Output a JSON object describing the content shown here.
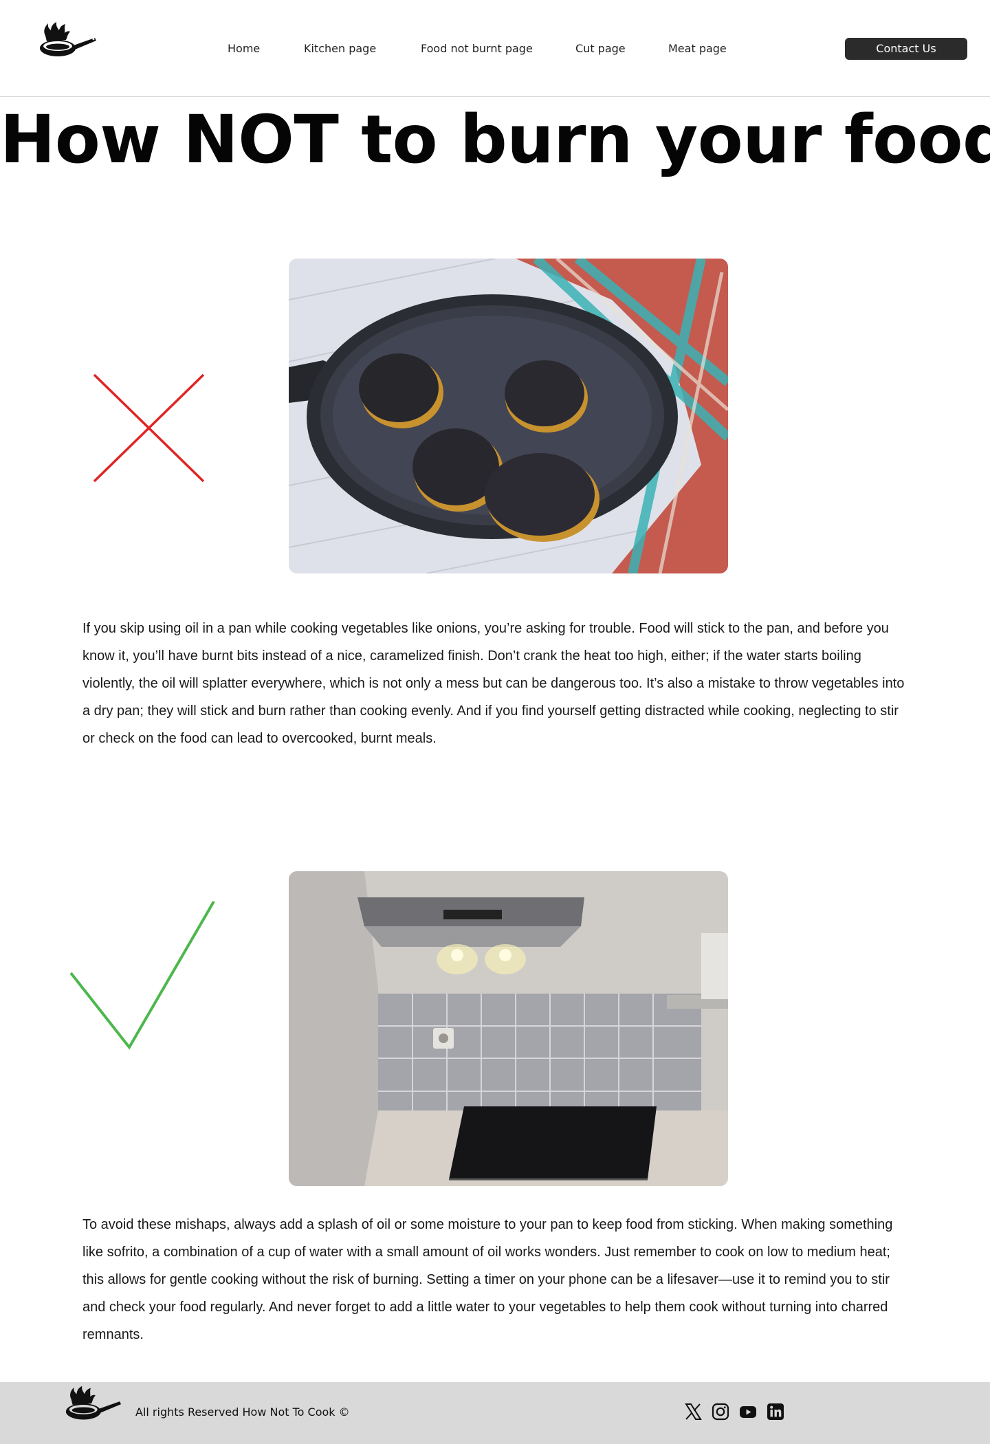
{
  "nav": {
    "items": [
      {
        "label": "Home"
      },
      {
        "label": "Kitchen page"
      },
      {
        "label": "Food not burnt page"
      },
      {
        "label": "Cut page"
      },
      {
        "label": "Meat page"
      }
    ],
    "contact_label": "Contact Us"
  },
  "page": {
    "title": "How NOT to burn your food"
  },
  "sections": [
    {
      "mark_icon": "red-x-icon",
      "mark_color": "#e02424",
      "image": "burnt-food-in-pan",
      "text": "If you skip using oil in a pan while cooking vegetables like onions, you’re asking for trouble. Food will stick to the pan, and before you know it, you’ll have burnt bits instead of a nice, caramelized finish. Don’t crank the heat too high, either; if the water starts boiling violently, the oil will splatter everywhere, which is not only a mess but can be dangerous too. It’s also a mistake to throw vegetables into a dry pan; they will stick and burn rather than cooking evenly. And if you find yourself getting distracted while cooking, neglecting to stir or check on the food can lead to overcooked, burnt meals."
    },
    {
      "mark_icon": "green-check-icon",
      "mark_color": "#4cb84c",
      "image": "clean-kitchen-stove",
      "text": "To avoid these mishaps, always add a splash of oil or some moisture to your pan to keep food from sticking. When making something like sofrito, a combination of a cup of water with a small amount of oil works wonders. Just remember to cook on low to medium heat; this allows for gentle cooking without the risk of burning. Setting a timer on your phone can be a lifesaver—use it to remind you to stir and check your food regularly. And never forget to add a little water to your vegetables to help them cook without turning into charred remnants."
    }
  ],
  "footer": {
    "copyright": "All rights Reserved How Not To Cook ©",
    "social_icons": [
      "x-icon",
      "instagram-icon",
      "youtube-icon",
      "linkedin-icon"
    ]
  },
  "colors": {
    "button_bg": "#2b2b2b",
    "footer_bg": "#d9d9d9"
  }
}
